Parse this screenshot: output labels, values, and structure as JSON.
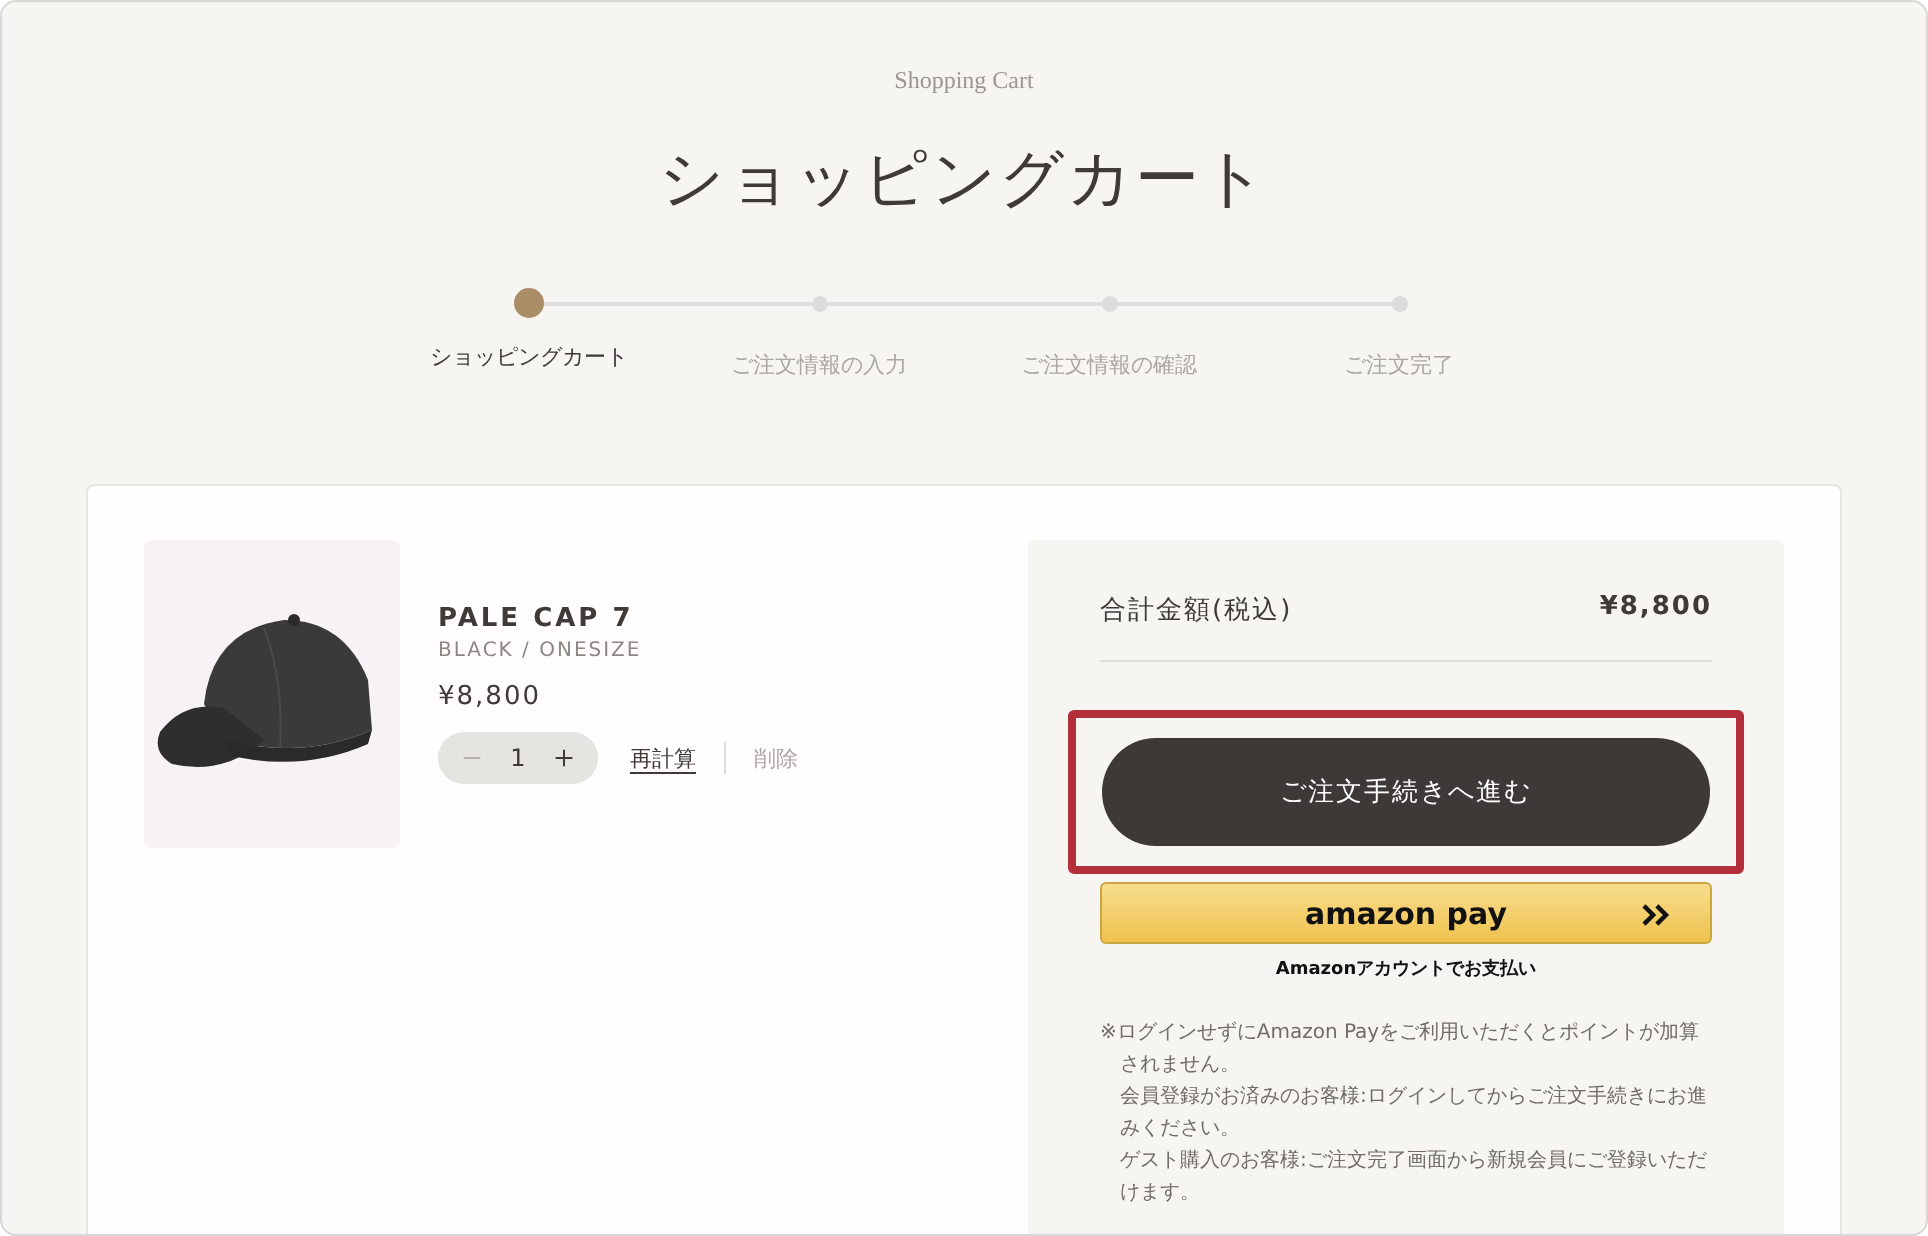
{
  "header": {
    "subtitle": "Shopping Cart",
    "title": "ショッピングカート"
  },
  "steps": [
    {
      "label": "ショッピングカート",
      "selected": true
    },
    {
      "label": "ご注文情報の入力",
      "selected": false
    },
    {
      "label": "ご注文情報の確認",
      "selected": false
    },
    {
      "label": "ご注文完了",
      "selected": false
    }
  ],
  "cart_items": [
    {
      "name": "PALE CAP 7",
      "variant": "BLACK / ONESIZE",
      "price": "¥8,800",
      "quantity": "1",
      "minus_disabled": true,
      "recalc": "再計算",
      "delete": "削除"
    }
  ],
  "summary": {
    "total_label": "合計金額(税込)",
    "total_value": "¥8,800",
    "checkout_button": {
      "label": "ご注文手続きへ進む",
      "highlighted": true
    },
    "amazon_pay": {
      "logo": "amazon pay",
      "caption": "Amazonアカウントでお支払い"
    },
    "notes": [
      "※ログインせずにAmazon Payをご利用いただくとポイントが加算されません。",
      "会員登録がお済みのお客様:ログインしてからご注文手続きにお進みください。",
      "ゲスト購入のお客様:ご注文完了画面から新規会員にご登録いただけます。"
    ]
  }
}
